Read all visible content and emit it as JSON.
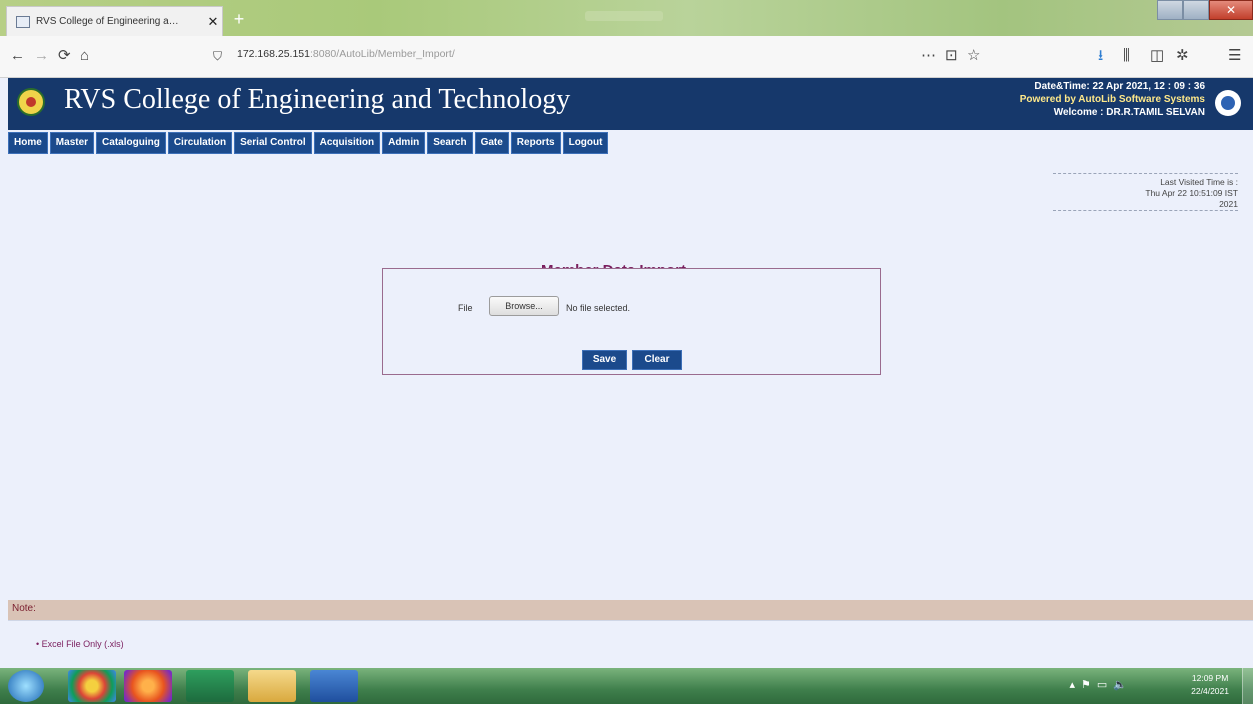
{
  "browser": {
    "tab_title": "RVS College of Engineering a…",
    "tab_close": "✕",
    "new_tab": "+",
    "url_host": "172.168.25.151",
    "url_path": ":8080/AutoLib/Member_Import/",
    "nav_icons": {
      "back": "←",
      "forward": "→",
      "reload": "⟳",
      "home": "⌂",
      "more": "⋯",
      "pocket": "⊡",
      "star": "☆",
      "menu": "☰"
    }
  },
  "header": {
    "college_name": "RVS College of Engineering and Technology",
    "datetime": "Date&Time:  22 Apr 2021,  12 : 09 : 36",
    "powered_by": "Powered by AutoLib Software Systems",
    "welcome": "Welcome  :  DR.R.TAMIL SELVAN"
  },
  "menu": [
    "Home",
    "Master",
    "Cataloguing",
    "Circulation",
    "Serial Control",
    "Acquisition",
    "Admin",
    "Search",
    "Gate",
    "Reports",
    "Logout"
  ],
  "last_visit": {
    "label": "Last Visited Time is :",
    "value": "Thu Apr 22 10:51:09 IST",
    "year": "2021"
  },
  "form": {
    "title": "Member Data Import",
    "file_label": "File",
    "browse_label": "Browse...",
    "no_file_text": "No file selected.",
    "save_label": "Save",
    "clear_label": "Clear"
  },
  "note": {
    "heading": "Note:",
    "item": "• Excel File Only (.xls)"
  },
  "taskbar": {
    "time": "12:09 PM",
    "date": "22/4/2021"
  },
  "colors": {
    "header_bg": "#16386b",
    "menu_bg": "#1b4a8c",
    "title_color": "#7a1e5e",
    "content_bg": "#ecf0fb"
  }
}
